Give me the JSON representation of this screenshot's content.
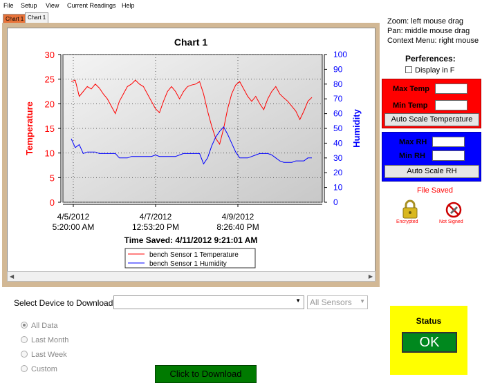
{
  "menu": [
    "File",
    "Setup",
    "View",
    "Current Readings",
    "Help"
  ],
  "tabs": [
    "Chart 1",
    "Chart 1"
  ],
  "chart_data": {
    "type": "line",
    "title": "Chart 1",
    "ylabel_left": "Temperature",
    "ylabel_right": "Humidity",
    "y_left_ticks": [
      "0",
      "5",
      "10",
      "15",
      "20",
      "25",
      "30"
    ],
    "y_right_ticks": [
      "0",
      "10",
      "20",
      "30",
      "40",
      "50",
      "60",
      "70",
      "80",
      "90",
      "100"
    ],
    "ylim_left": [
      0,
      30
    ],
    "ylim_right": [
      0,
      100
    ],
    "x_ticks": [
      {
        "date": "4/5/2012",
        "time": "5:20:00 AM"
      },
      {
        "date": "4/7/2012",
        "time": "12:53:20 PM"
      },
      {
        "date": "4/9/2012",
        "time": "8:26:40 PM"
      }
    ],
    "time_saved": "Time Saved: 4/11/2012 9:21:01 AM",
    "grid": true,
    "legend_position": "bottom-center",
    "series": [
      {
        "name": "bench Sensor 1 Temperature",
        "axis": "left",
        "color": "#ff0000",
        "x": [
          0,
          1,
          2,
          3,
          4,
          5,
          6,
          7,
          8,
          9,
          10,
          11,
          12,
          13,
          14,
          15,
          16,
          17,
          18,
          19,
          20,
          21,
          22,
          23,
          24,
          25,
          26,
          27,
          28,
          29,
          30,
          31,
          32,
          33,
          34,
          35,
          36,
          37,
          38,
          39,
          40,
          41,
          42,
          43,
          44,
          45,
          46,
          47,
          48,
          49,
          50,
          51,
          52,
          53,
          54,
          55,
          56,
          57,
          58,
          59,
          60
        ],
        "y": [
          24.5,
          24.8,
          21.5,
          22.5,
          23.5,
          23.0,
          24.0,
          23.2,
          22.0,
          21.0,
          19.5,
          18.0,
          20.5,
          22.0,
          23.5,
          24.0,
          24.8,
          24.0,
          23.5,
          22.0,
          20.5,
          19.0,
          18.2,
          20.5,
          22.5,
          23.5,
          22.5,
          21.0,
          22.5,
          23.5,
          23.8,
          24.0,
          24.5,
          22.0,
          18.5,
          15.5,
          13.0,
          11.8,
          15.0,
          19.0,
          22.0,
          23.8,
          24.5,
          23.0,
          21.5,
          20.5,
          21.5,
          20.0,
          18.8,
          21.0,
          22.5,
          23.5,
          22.0,
          21.2,
          20.5,
          19.5,
          18.5,
          16.8,
          18.5,
          20.5,
          21.3
        ]
      },
      {
        "name": "bench Sensor 1 Humidity",
        "axis": "right",
        "color": "#0000ff",
        "x": [
          0,
          1,
          2,
          3,
          4,
          5,
          6,
          7,
          8,
          9,
          10,
          11,
          12,
          13,
          14,
          15,
          16,
          17,
          18,
          19,
          20,
          21,
          22,
          23,
          24,
          25,
          26,
          27,
          28,
          29,
          30,
          31,
          32,
          33,
          34,
          35,
          36,
          37,
          38,
          39,
          40,
          41,
          42,
          43,
          44,
          45,
          46,
          47,
          48,
          49,
          50,
          51,
          52,
          53,
          54,
          55,
          56,
          57,
          58,
          59,
          60
        ],
        "y": [
          43,
          37,
          39,
          33,
          34,
          34,
          34,
          33,
          33,
          33,
          33,
          33,
          30,
          30,
          30,
          31,
          31,
          31,
          31,
          31,
          31,
          32,
          31,
          31,
          31,
          31,
          31,
          32,
          33,
          33,
          33,
          33,
          33,
          26,
          30,
          38,
          44,
          48,
          51,
          46,
          40,
          34,
          30,
          30,
          30,
          31,
          32,
          33,
          33,
          33,
          32,
          30,
          28,
          27,
          27,
          27,
          28,
          28,
          28,
          30,
          30
        ]
      }
    ]
  },
  "instructions": [
    "Zoom: left mouse  drag",
    "Pan: middle mouse  drag",
    "Context Menu: right mouse"
  ],
  "preferences": {
    "title": "Perferences:",
    "display_f": "Display in F"
  },
  "temp_panel": {
    "max_label": "Max Temp",
    "min_label": "Min Temp",
    "button": "Auto Scale Temperature",
    "color": "#ff0000"
  },
  "rh_panel": {
    "max_label": "Max RH",
    "min_label": "Min RH",
    "button": "Auto Scale RH",
    "color": "#0000ff"
  },
  "file_status": {
    "saved": "File Saved",
    "encrypted": "Encrypted",
    "not_signed": "Not Signed"
  },
  "download": {
    "select_label": "Select Device to Download",
    "device_value": "",
    "sensor_value": "All Sensors",
    "ranges": [
      "All Data",
      "Last Month",
      "Last Week",
      "Custom"
    ],
    "selected_range": "All Data",
    "button": "Click to Download"
  },
  "status": {
    "title": "Status",
    "value": "OK"
  }
}
